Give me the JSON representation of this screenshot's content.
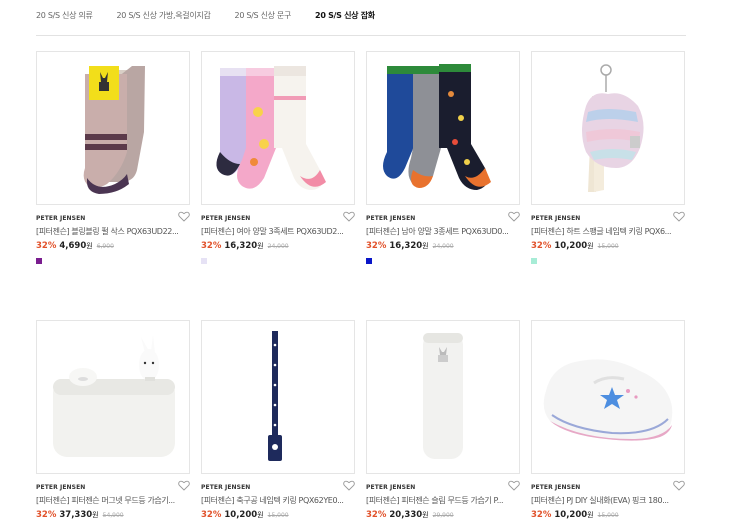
{
  "tabs": [
    {
      "label": "20 S/S 신상 의류"
    },
    {
      "label": "20 S/S 신상 가방,옥걸이지갑"
    },
    {
      "label": "20 S/S 신상 문구"
    },
    {
      "label": "20 S/S 신상 잡화",
      "active": true
    }
  ],
  "products": [
    {
      "brand": "PETER JENSEN",
      "name": "[피터젠슨] 블링블링 펄 삭스 PQX63UD22...",
      "rate": "32%",
      "price": "4,690",
      "won": "원",
      "original": "6,900",
      "swatch": "#7a1d8f",
      "image": "sock-icon"
    },
    {
      "brand": "PETER JENSEN",
      "name": "[피터젠슨] 여아 양말 3족세트 PQX63UD2...",
      "rate": "32%",
      "price": "16,320",
      "won": "원",
      "original": "24,000",
      "swatch": "#e6e2f5",
      "image": "sock-icon"
    },
    {
      "brand": "PETER JENSEN",
      "name": "[피터젠슨] 남아 양말 3종세트 PQX63UD0...",
      "rate": "32%",
      "price": "16,320",
      "won": "원",
      "original": "24,000",
      "swatch": "#0a16c8",
      "image": "sock-icon"
    },
    {
      "brand": "PETER JENSEN",
      "name": "[피터젠슨] 하트 스팽글 네임텍 키링 PQX6...",
      "rate": "32%",
      "price": "10,200",
      "won": "원",
      "original": "15,000",
      "swatch": "#a7ecd6",
      "image": "keyring-icon"
    },
    {
      "brand": "PETER JENSEN",
      "name": "[피터젠슨] 피터젠슨 머그넷 무드등 가습기...",
      "rate": "32%",
      "price": "37,330",
      "won": "원",
      "original": "54,900",
      "swatch": "",
      "image": "humidifier-icon"
    },
    {
      "brand": "PETER JENSEN",
      "name": "[피터젠슨] 축구공 네임텍 키링 PQX62YE0...",
      "rate": "32%",
      "price": "10,200",
      "won": "원",
      "original": "15,000",
      "swatch": "",
      "image": "lanyard-icon"
    },
    {
      "brand": "PETER JENSEN",
      "name": "[피터젠슨] 피터젠슨 슬림 무드등 가습기 P...",
      "rate": "32%",
      "price": "20,330",
      "won": "원",
      "original": "29,900",
      "swatch": "",
      "image": "slim-humidifier-icon"
    },
    {
      "brand": "PETER JENSEN",
      "name": "[피터젠슨] PJ DIY 실내화(EVA) 핑크 180...",
      "rate": "32%",
      "price": "10,200",
      "won": "원",
      "original": "15,000",
      "swatch": "",
      "image": "shoe-icon"
    }
  ]
}
